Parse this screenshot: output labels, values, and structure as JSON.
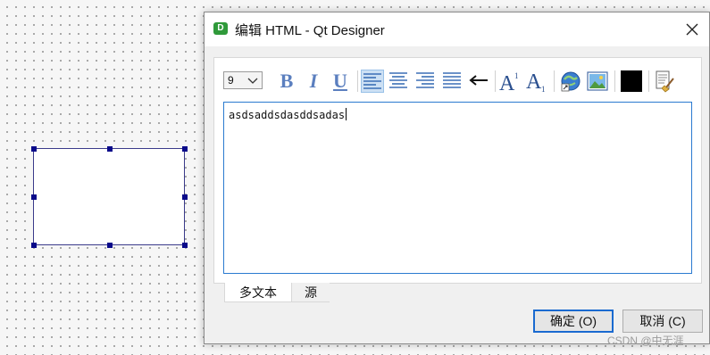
{
  "window": {
    "app_icon_letter": "D",
    "title": "编辑 HTML - Qt Designer"
  },
  "toolbar": {
    "font_size": "9",
    "bold_label": "B",
    "italic_label": "I",
    "underline_label": "U",
    "icons": [
      "align-left-icon",
      "align-center-icon",
      "align-right-icon",
      "align-justify-icon",
      "text-direction-icon",
      "superscript-icon",
      "subscript-icon",
      "link-icon",
      "image-icon",
      "text-color-icon",
      "simplify-html-icon"
    ],
    "text_color": "#000000"
  },
  "editor": {
    "text": "asdsaddsdasddsadas"
  },
  "tabs": [
    {
      "label": "多文本",
      "selected": true
    },
    {
      "label": "源",
      "selected": false
    }
  ],
  "buttons": {
    "ok": "确定 (O)",
    "cancel": "取消 (C)"
  },
  "watermark": "CSDN @中无涯"
}
